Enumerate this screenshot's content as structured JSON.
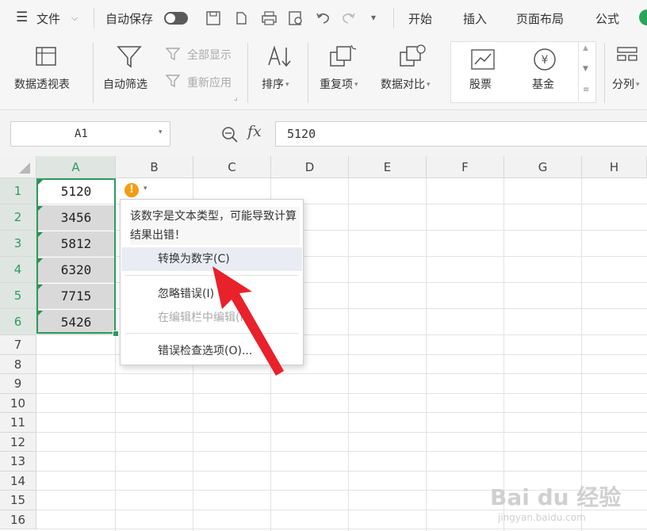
{
  "menubar": {
    "hamburger_icon": "hamburger-icon",
    "file_label": "文件",
    "autosave_label": "自动保存",
    "tabs": [
      "开始",
      "插入",
      "页面布局",
      "公式"
    ]
  },
  "ribbon": {
    "pivot_label": "数据透视表",
    "autofilter_label": "自动筛选",
    "show_all_label": "全部显示",
    "reapply_label": "重新应用",
    "sort_label": "排序",
    "duplicates_label": "重复项",
    "compare_label": "数据对比",
    "stocks_label": "股票",
    "funds_label": "基金",
    "split_label": "分列"
  },
  "formula_bar": {
    "name_box": "A1",
    "fx_label": "fx",
    "value": "5120"
  },
  "grid": {
    "columns": [
      "A",
      "B",
      "C",
      "D",
      "E",
      "F",
      "G",
      "H"
    ],
    "rows": [
      "1",
      "2",
      "3",
      "4",
      "5",
      "6",
      "7",
      "8",
      "9",
      "10",
      "11",
      "12",
      "13",
      "14",
      "15",
      "16"
    ],
    "column_a_values": [
      "5120",
      "3456",
      "5812",
      "6320",
      "7715",
      "5426"
    ]
  },
  "error_popup": {
    "message": "该数字是文本类型，可能导致计算结果出错！",
    "items": {
      "convert": "转换为数字(C)",
      "ignore": "忽略错误(I)",
      "edit_in_bar": "在编辑栏中编辑(F)",
      "options": "错误检查选项(O)..."
    }
  },
  "watermark": {
    "brand": "Bai du 经验",
    "url": "jingyan.baidu.com"
  },
  "colors": {
    "accent": "#2e9a5e",
    "arrow": "#e8212b",
    "warning": "#f39c12"
  }
}
